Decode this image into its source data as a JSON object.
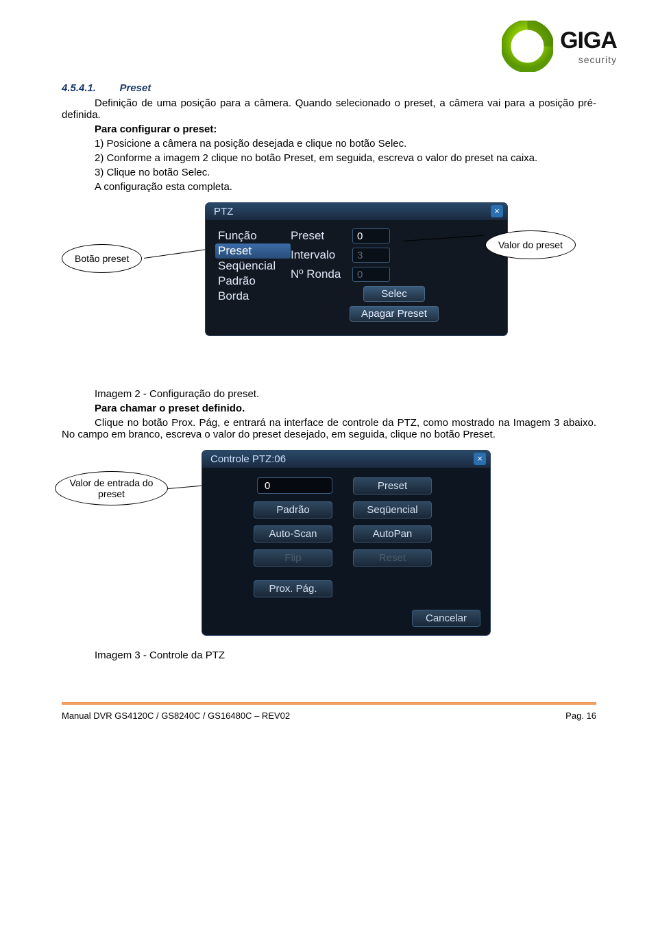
{
  "logo": {
    "brand": "GIGA",
    "sub": "security"
  },
  "section": {
    "num": "4.5.4.1.",
    "title": "Preset"
  },
  "para1a": "Definição de uma posição para a câmera. Quando selecionado o preset, a câmera vai para a posição pré-definida.",
  "para2": "Para configurar o preset:",
  "step1": "1) Posicione a câmera na posição desejada e clique no botão Selec.",
  "step2": "2) Conforme a imagem 2 clique no botão Preset, em seguida, escreva o valor do preset na caixa.",
  "step3": "3) Clique no botão Selec.",
  "step4": "A configuração esta completa.",
  "callout1": "Botão preset",
  "callout2": "Valor do preset",
  "callout3a": "Valor de entrada do",
  "callout3b": "preset",
  "ptz": {
    "title": "PTZ",
    "close": "×",
    "listLabel0": "Função",
    "listLabel1": "Preset",
    "listLabel2": "Seqüencial",
    "listLabel3": "Padrão",
    "listLabel4": "Borda",
    "f1label": "Preset",
    "f1val": "0",
    "f2label": "Intervalo",
    "f2val": "3",
    "f3label": "Nº Ronda",
    "f3val": "0",
    "btn1": "Selec",
    "btn2": "Apagar Preset"
  },
  "caption1": "Imagem 2 - Configuração do preset.",
  "para3": "Para chamar o preset definido.",
  "para4": "Clique no botão Prox. Pág, e entrará na interface de controle da PTZ, como mostrado na Imagem 3 abaixo. No campo em branco, escreva o valor do preset desejado, em seguida, clique no botão Preset.",
  "ptz2": {
    "title": "Controle PTZ:06",
    "close": "×",
    "inputval": "0",
    "b1": "Preset",
    "b2": "Padrão",
    "b3": "Seqüencial",
    "b4": "Auto-Scan",
    "b5": "AutoPan",
    "b6": "Flip",
    "b7": "Reset",
    "b8": "Prox. Pág.",
    "cancel": "Cancelar"
  },
  "caption2": "Imagem 3 - Controle da PTZ",
  "footer": {
    "left": "Manual DVR GS4120C / GS8240C / GS16480C – REV02",
    "right": "Pag. 16"
  }
}
